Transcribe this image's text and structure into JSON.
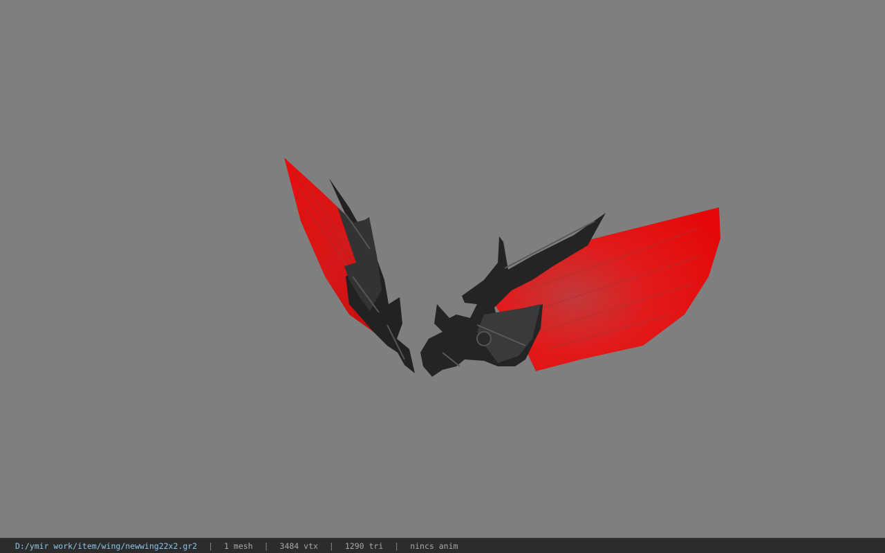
{
  "status": {
    "file_path": "D:/ymir work/item/wing/newwing22x2.gr2",
    "separator": "|",
    "mesh_count": "1 mesh",
    "vertex_count": "3484 vtx",
    "triangle_count": "1290 tri",
    "anim": "nincs anim"
  },
  "colors": {
    "background": "#7f7f7f",
    "wing_red": "#e01010",
    "armor_black": "#1e1e1e",
    "statusbar_bg": "#2c2c2c",
    "path_text": "#8fc4e6"
  }
}
